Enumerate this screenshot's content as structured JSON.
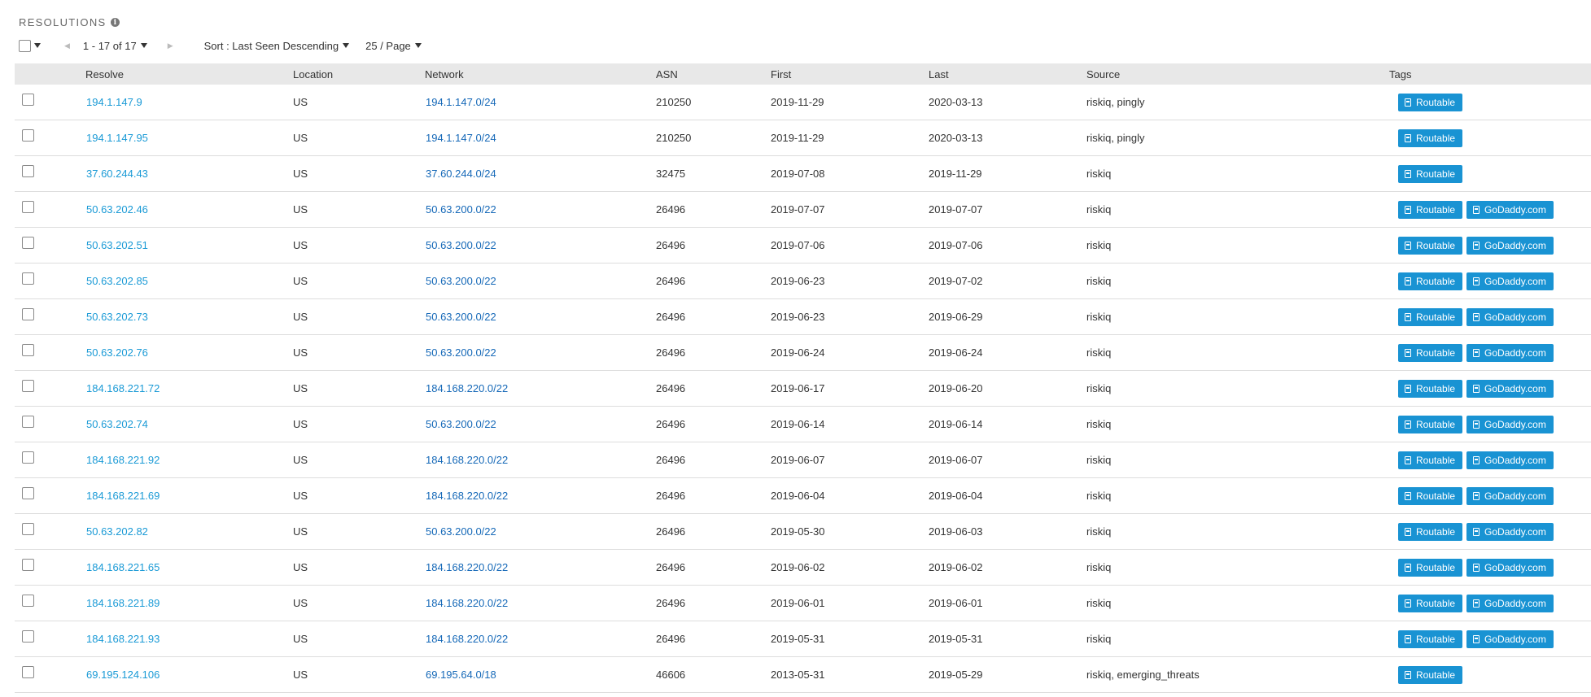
{
  "section": {
    "title": "RESOLUTIONS",
    "info_icon": "info-icon"
  },
  "toolbar": {
    "range_label": "1 - 17 of 17",
    "sort_label": "Sort : Last Seen Descending",
    "per_page_label": "25 / Page",
    "prev_icon": "◀",
    "next_icon": "▶"
  },
  "columns": {
    "resolve": "Resolve",
    "location": "Location",
    "network": "Network",
    "asn": "ASN",
    "first": "First",
    "last": "Last",
    "source": "Source",
    "tags": "Tags"
  },
  "colors": {
    "tag_bg": "#1993d3",
    "resolve_link": "#1a9ad6",
    "network_link": "#1669b8",
    "header_bg": "#e8e8e8"
  },
  "rows": [
    {
      "resolve": "194.1.147.9",
      "location": "US",
      "network": "194.1.147.0/24",
      "asn": "210250",
      "first": "2019-11-29",
      "last": "2020-03-13",
      "source": "riskiq, pingly",
      "tags": [
        "Routable"
      ]
    },
    {
      "resolve": "194.1.147.95",
      "location": "US",
      "network": "194.1.147.0/24",
      "asn": "210250",
      "first": "2019-11-29",
      "last": "2020-03-13",
      "source": "riskiq, pingly",
      "tags": [
        "Routable"
      ]
    },
    {
      "resolve": "37.60.244.43",
      "location": "US",
      "network": "37.60.244.0/24",
      "asn": "32475",
      "first": "2019-07-08",
      "last": "2019-11-29",
      "source": "riskiq",
      "tags": [
        "Routable"
      ]
    },
    {
      "resolve": "50.63.202.46",
      "location": "US",
      "network": "50.63.200.0/22",
      "asn": "26496",
      "first": "2019-07-07",
      "last": "2019-07-07",
      "source": "riskiq",
      "tags": [
        "Routable",
        "GoDaddy.com"
      ]
    },
    {
      "resolve": "50.63.202.51",
      "location": "US",
      "network": "50.63.200.0/22",
      "asn": "26496",
      "first": "2019-07-06",
      "last": "2019-07-06",
      "source": "riskiq",
      "tags": [
        "Routable",
        "GoDaddy.com"
      ]
    },
    {
      "resolve": "50.63.202.85",
      "location": "US",
      "network": "50.63.200.0/22",
      "asn": "26496",
      "first": "2019-06-23",
      "last": "2019-07-02",
      "source": "riskiq",
      "tags": [
        "Routable",
        "GoDaddy.com"
      ]
    },
    {
      "resolve": "50.63.202.73",
      "location": "US",
      "network": "50.63.200.0/22",
      "asn": "26496",
      "first": "2019-06-23",
      "last": "2019-06-29",
      "source": "riskiq",
      "tags": [
        "Routable",
        "GoDaddy.com"
      ]
    },
    {
      "resolve": "50.63.202.76",
      "location": "US",
      "network": "50.63.200.0/22",
      "asn": "26496",
      "first": "2019-06-24",
      "last": "2019-06-24",
      "source": "riskiq",
      "tags": [
        "Routable",
        "GoDaddy.com"
      ]
    },
    {
      "resolve": "184.168.221.72",
      "location": "US",
      "network": "184.168.220.0/22",
      "asn": "26496",
      "first": "2019-06-17",
      "last": "2019-06-20",
      "source": "riskiq",
      "tags": [
        "Routable",
        "GoDaddy.com"
      ]
    },
    {
      "resolve": "50.63.202.74",
      "location": "US",
      "network": "50.63.200.0/22",
      "asn": "26496",
      "first": "2019-06-14",
      "last": "2019-06-14",
      "source": "riskiq",
      "tags": [
        "Routable",
        "GoDaddy.com"
      ]
    },
    {
      "resolve": "184.168.221.92",
      "location": "US",
      "network": "184.168.220.0/22",
      "asn": "26496",
      "first": "2019-06-07",
      "last": "2019-06-07",
      "source": "riskiq",
      "tags": [
        "Routable",
        "GoDaddy.com"
      ]
    },
    {
      "resolve": "184.168.221.69",
      "location": "US",
      "network": "184.168.220.0/22",
      "asn": "26496",
      "first": "2019-06-04",
      "last": "2019-06-04",
      "source": "riskiq",
      "tags": [
        "Routable",
        "GoDaddy.com"
      ]
    },
    {
      "resolve": "50.63.202.82",
      "location": "US",
      "network": "50.63.200.0/22",
      "asn": "26496",
      "first": "2019-05-30",
      "last": "2019-06-03",
      "source": "riskiq",
      "tags": [
        "Routable",
        "GoDaddy.com"
      ]
    },
    {
      "resolve": "184.168.221.65",
      "location": "US",
      "network": "184.168.220.0/22",
      "asn": "26496",
      "first": "2019-06-02",
      "last": "2019-06-02",
      "source": "riskiq",
      "tags": [
        "Routable",
        "GoDaddy.com"
      ]
    },
    {
      "resolve": "184.168.221.89",
      "location": "US",
      "network": "184.168.220.0/22",
      "asn": "26496",
      "first": "2019-06-01",
      "last": "2019-06-01",
      "source": "riskiq",
      "tags": [
        "Routable",
        "GoDaddy.com"
      ]
    },
    {
      "resolve": "184.168.221.93",
      "location": "US",
      "network": "184.168.220.0/22",
      "asn": "26496",
      "first": "2019-05-31",
      "last": "2019-05-31",
      "source": "riskiq",
      "tags": [
        "Routable",
        "GoDaddy.com"
      ]
    },
    {
      "resolve": "69.195.124.106",
      "location": "US",
      "network": "69.195.64.0/18",
      "asn": "46606",
      "first": "2013-05-31",
      "last": "2019-05-29",
      "source": "riskiq, emerging_threats",
      "tags": [
        "Routable"
      ]
    }
  ]
}
